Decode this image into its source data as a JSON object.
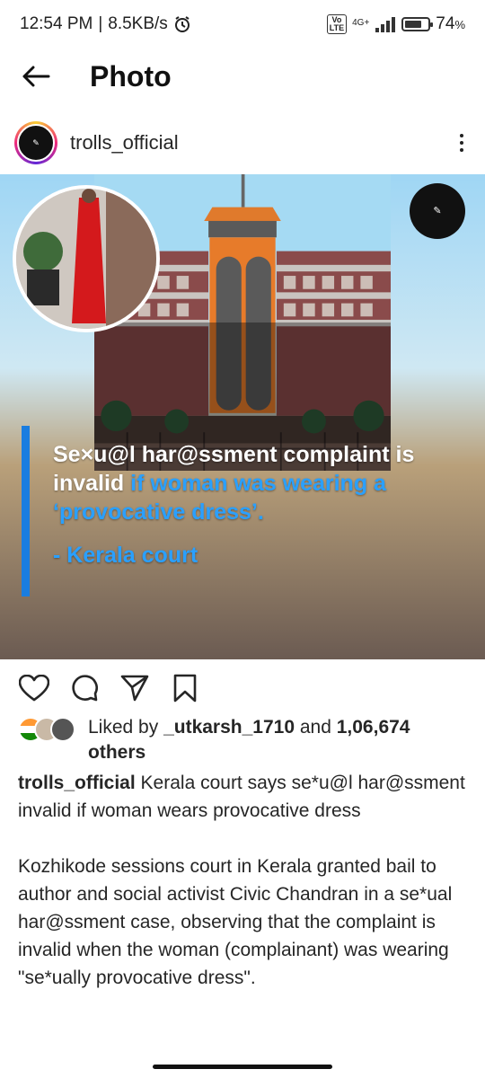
{
  "status_bar": {
    "time": "12:54 PM",
    "speed": "8.5KB/s",
    "network": "4G+",
    "volte": "Vo LTE",
    "battery": "74",
    "battery_level": 0.74
  },
  "app_bar": {
    "title": "Photo"
  },
  "post": {
    "username": "trolls_official",
    "image": {
      "headline": {
        "part1": "Se×u@l har@ssment complaint is invalid ",
        "part2": "if woman was wearing a ‘provocative dress’.",
        "source": "- Kerala court"
      }
    },
    "likes": {
      "prefix": "Liked by",
      "liker": "_utkarsh_1710",
      "and": "and",
      "count": "1,06,674",
      "others": "others"
    },
    "caption": {
      "username": "trolls_official",
      "text1": "Kerala court says se*u@l har@ssment invalid if woman wears provocative dress",
      "text2": "Kozhikode sessions court in Kerala granted bail to author and social activist Civic Chandran in a se*ual har@ssment case, observing that the complaint is invalid when the woman (complainant) was wearing \"se*ually provocative dress\"."
    }
  },
  "icons": [
    "back-arrow-icon",
    "more-vertical-icon",
    "heart-icon",
    "comment-icon",
    "share-icon",
    "bookmark-icon"
  ]
}
